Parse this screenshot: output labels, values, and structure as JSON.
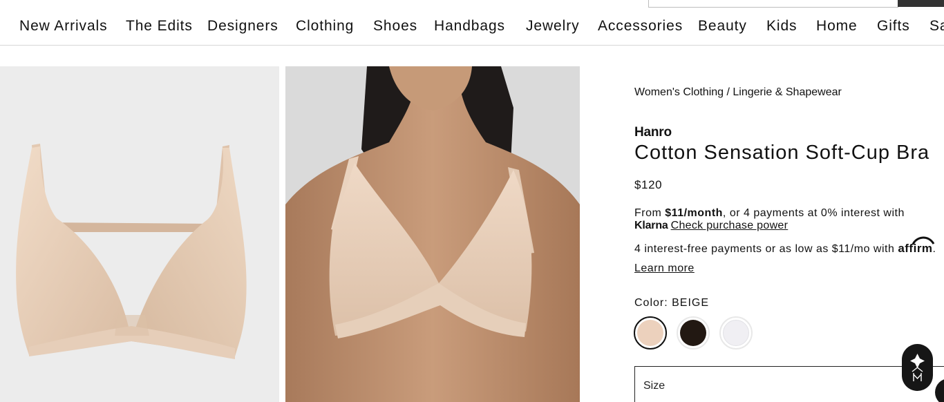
{
  "nav": {
    "items": [
      "New Arrivals",
      "The Edits",
      "Designers",
      "Clothing",
      "Shoes",
      "Handbags",
      "Jewelry",
      "Accessories",
      "Beauty",
      "Kids",
      "Home",
      "Gifts",
      "Sa"
    ]
  },
  "breadcrumb": {
    "level1": "Women's Clothing",
    "separator": " / ",
    "level2": "Lingerie & Shapewear"
  },
  "product": {
    "brand": "Hanro",
    "title": "Cotton Sensation Soft-Cup Bra",
    "price": "$120"
  },
  "klarna": {
    "prefix": "From ",
    "amount": "$11/month",
    "suffix": ", or 4 payments at 0% interest with",
    "logo_text": "Klarna",
    "link": "Check purchase power"
  },
  "affirm": {
    "text": "4 interest-free payments or as low as $11/mo with",
    "logo_text": "affirm",
    "trailing": ".",
    "link": "Learn more"
  },
  "color": {
    "label": "Color: ",
    "selected": "BEIGE",
    "swatches": [
      {
        "name": "beige",
        "hex": "#ecd1bd",
        "selected": true
      },
      {
        "name": "black",
        "hex": "#221812",
        "selected": false
      },
      {
        "name": "white",
        "hex": "#f0eff3",
        "selected": false
      }
    ]
  },
  "size": {
    "label": "Size"
  },
  "colors": {
    "text": "#111111",
    "divider": "#d6d6d6",
    "fab": "#161616"
  },
  "icons": [
    "bra-product-image",
    "model-product-image",
    "assistant-diamond-icon"
  ]
}
